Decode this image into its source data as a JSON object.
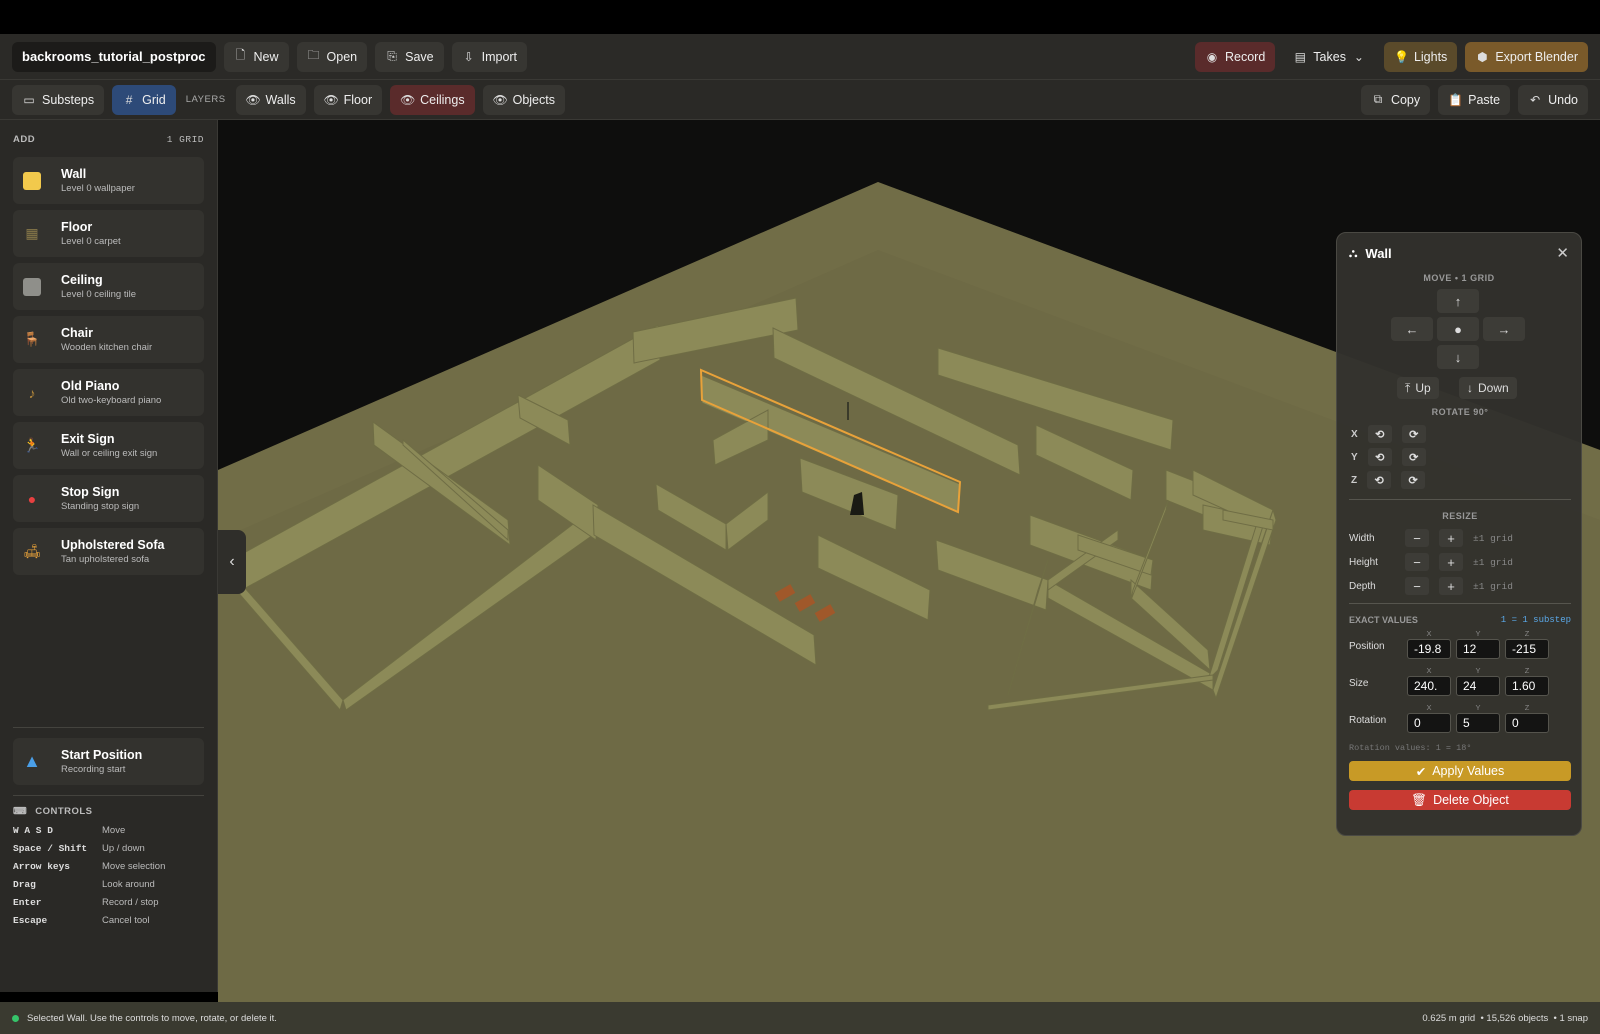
{
  "toolbar": {
    "project_name": "backrooms_tutorial_postproc",
    "new_label": "New",
    "open_label": "Open",
    "save_label": "Save",
    "import_label": "Import",
    "record_label": "Record",
    "takes_label": "Takes",
    "lights_label": "Lights",
    "export_label": "Export Blender"
  },
  "subbar": {
    "substeps_label": "Substeps",
    "grid_label": "Grid",
    "layers_label": "LAYERS",
    "walls_label": "Walls",
    "floor_label": "Floor",
    "ceilings_label": "Ceilings",
    "objects_label": "Objects",
    "copy_label": "Copy",
    "paste_label": "Paste",
    "undo_label": "Undo"
  },
  "sidebar": {
    "add_label": "ADD",
    "grid_count": "1 GRID",
    "items": [
      {
        "name": "Wall",
        "desc": "Level 0 wallpaper",
        "icon": "wall-swatch-icon",
        "color": "#f2c94c"
      },
      {
        "name": "Floor",
        "desc": "Level 0 carpet",
        "icon": "floor-grid-icon",
        "color": "#8a7a4a"
      },
      {
        "name": "Ceiling",
        "desc": "Level 0 ceiling tile",
        "icon": "ceiling-tile-icon",
        "color": "#8f8f8a"
      },
      {
        "name": "Chair",
        "desc": "Wooden kitchen chair",
        "icon": "chair-icon",
        "color": "#f0a030"
      },
      {
        "name": "Old Piano",
        "desc": "Old two-keyboard piano",
        "icon": "music-note-icon",
        "color": "#b88a3a"
      },
      {
        "name": "Exit Sign",
        "desc": "Wall or ceiling exit sign",
        "icon": "running-man-icon",
        "color": "#3ec46a"
      },
      {
        "name": "Stop Sign",
        "desc": "Standing stop sign",
        "icon": "stop-circle-icon",
        "color": "#e84040"
      },
      {
        "name": "Upholstered Sofa",
        "desc": "Tan upholstered sofa",
        "icon": "sofa-icon",
        "color": "#e8a23a"
      }
    ],
    "start": {
      "name": "Start Position",
      "desc": "Recording start",
      "icon": "arrow-up-icon",
      "color": "#4a9fe8"
    },
    "controls_label": "CONTROLS",
    "controls": [
      {
        "key": "W A S D",
        "action": "Move"
      },
      {
        "key": "Space / Shift",
        "action": "Up / down"
      },
      {
        "key": "Arrow keys",
        "action": "Move selection"
      },
      {
        "key": "Drag",
        "action": "Look around"
      },
      {
        "key": "Enter",
        "action": "Record / stop"
      },
      {
        "key": "Escape",
        "action": "Cancel tool"
      }
    ]
  },
  "panel": {
    "title": "Wall",
    "move_label": "MOVE • 1 GRID",
    "up_label": "Up",
    "down_label": "Down",
    "rotate_label": "ROTATE 90°",
    "axes": [
      "X",
      "Y",
      "Z"
    ],
    "resize_label": "RESIZE",
    "resize": [
      {
        "label": "Width",
        "hint": "±1 grid"
      },
      {
        "label": "Height",
        "hint": "±1 grid"
      },
      {
        "label": "Depth",
        "hint": "±1 grid"
      }
    ],
    "exact_label": "EXACT VALUES",
    "exact_hint": "1 = 1 substep",
    "axis_x": "X",
    "axis_y": "Y",
    "axis_z": "Z",
    "position_label": "Position",
    "position": [
      "-19.8",
      "12",
      "-215"
    ],
    "size_label": "Size",
    "size": [
      "240.",
      "24",
      "1.60"
    ],
    "rotation_label": "Rotation",
    "rotation": [
      "0",
      "5",
      "0"
    ],
    "rotation_note": "Rotation values: 1 = 18°",
    "apply_label": "Apply Values",
    "delete_label": "Delete Object"
  },
  "status": {
    "message": "Selected Wall. Use the controls to move, rotate, or delete it.",
    "right": "0.625 m grid  • 15,526 objects  • 1 snap"
  },
  "colors": {
    "accent_blue": "#2d4a78",
    "record_red": "#5a2b2b",
    "apply_gold": "#c89a26",
    "delete_red": "#c83a32",
    "floor": "#6e6a45",
    "wall": "#8c8a58"
  }
}
